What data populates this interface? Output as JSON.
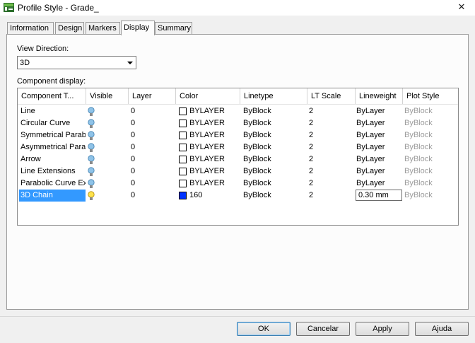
{
  "window": {
    "title": "Profile Style - Grade_",
    "close_glyph": "✕",
    "accent_color": "#3399ff"
  },
  "tabs": [
    {
      "label": "Information",
      "active": false
    },
    {
      "label": "Design",
      "active": false
    },
    {
      "label": "Markers",
      "active": false
    },
    {
      "label": "Display",
      "active": true
    },
    {
      "label": "Summary",
      "active": false
    }
  ],
  "view_direction": {
    "label": "View Direction:",
    "selected": "3D"
  },
  "component_display": {
    "label": "Component display:",
    "columns": [
      "Component T...",
      "Visible",
      "Layer",
      "Color",
      "Linetype",
      "LT Scale",
      "Lineweight",
      "Plot Style"
    ],
    "rows": [
      {
        "component": "Line",
        "visible_icon": "lightbulb-off-icon",
        "layer": "0",
        "color_swatch": "#ffffff",
        "color": "BYLAYER",
        "linetype": "ByBlock",
        "lt_scale": "2",
        "lineweight": "ByLayer",
        "plot_style": "ByBlock"
      },
      {
        "component": "Circular Curve",
        "visible_icon": "lightbulb-off-icon",
        "layer": "0",
        "color_swatch": "#ffffff",
        "color": "BYLAYER",
        "linetype": "ByBlock",
        "lt_scale": "2",
        "lineweight": "ByLayer",
        "plot_style": "ByBlock"
      },
      {
        "component": "Symmetrical Parabo",
        "visible_icon": "lightbulb-off-icon",
        "layer": "0",
        "color_swatch": "#ffffff",
        "color": "BYLAYER",
        "linetype": "ByBlock",
        "lt_scale": "2",
        "lineweight": "ByLayer",
        "plot_style": "ByBlock"
      },
      {
        "component": "Asymmetrical Parab",
        "visible_icon": "lightbulb-off-icon",
        "layer": "0",
        "color_swatch": "#ffffff",
        "color": "BYLAYER",
        "linetype": "ByBlock",
        "lt_scale": "2",
        "lineweight": "ByLayer",
        "plot_style": "ByBlock"
      },
      {
        "component": "Arrow",
        "visible_icon": "lightbulb-off-icon",
        "layer": "0",
        "color_swatch": "#ffffff",
        "color": "BYLAYER",
        "linetype": "ByBlock",
        "lt_scale": "2",
        "lineweight": "ByLayer",
        "plot_style": "ByBlock"
      },
      {
        "component": "Line Extensions",
        "visible_icon": "lightbulb-off-icon",
        "layer": "0",
        "color_swatch": "#ffffff",
        "color": "BYLAYER",
        "linetype": "ByBlock",
        "lt_scale": "2",
        "lineweight": "ByLayer",
        "plot_style": "ByBlock"
      },
      {
        "component": "Parabolic Curve Ex",
        "visible_icon": "lightbulb-off-icon",
        "layer": "0",
        "color_swatch": "#ffffff",
        "color": "BYLAYER",
        "linetype": "ByBlock",
        "lt_scale": "2",
        "lineweight": "ByLayer",
        "plot_style": "ByBlock"
      },
      {
        "component": "3D Chain",
        "visible_icon": "lightbulb-on-icon",
        "layer": "0",
        "color_swatch": "#0033ff",
        "color": "160",
        "linetype": "ByBlock",
        "lt_scale": "2",
        "lineweight": "0.30 mm",
        "plot_style": "ByBlock",
        "selected": true
      }
    ]
  },
  "buttons": {
    "ok": "OK",
    "cancel": "Cancelar",
    "apply": "Apply",
    "help": "Ajuda"
  }
}
